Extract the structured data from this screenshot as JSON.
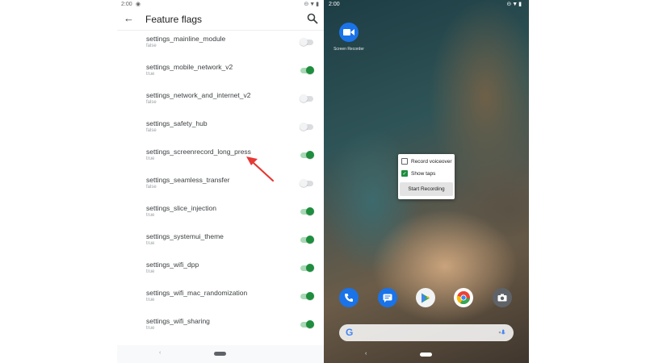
{
  "settings_screen": {
    "status_time": "2:00",
    "title": "Feature flags",
    "flags": [
      {
        "name": "settings_mainline_module",
        "value": "false",
        "enabled": false
      },
      {
        "name": "settings_mobile_network_v2",
        "value": "true",
        "enabled": true
      },
      {
        "name": "settings_network_and_internet_v2",
        "value": "false",
        "enabled": false
      },
      {
        "name": "settings_safety_hub",
        "value": "false",
        "enabled": false
      },
      {
        "name": "settings_screenrecord_long_press",
        "value": "true",
        "enabled": true
      },
      {
        "name": "settings_seamless_transfer",
        "value": "false",
        "enabled": false
      },
      {
        "name": "settings_slice_injection",
        "value": "true",
        "enabled": true
      },
      {
        "name": "settings_systemui_theme",
        "value": "true",
        "enabled": true
      },
      {
        "name": "settings_wifi_dpp",
        "value": "true",
        "enabled": true
      },
      {
        "name": "settings_wifi_mac_randomization",
        "value": "true",
        "enabled": true
      },
      {
        "name": "settings_wifi_sharing",
        "value": "true",
        "enabled": true
      }
    ]
  },
  "home_screen": {
    "status_time": "2:00",
    "shortcut_label": "Screen Recorder",
    "popup": {
      "options": [
        {
          "label": "Record voiceover",
          "checked": false
        },
        {
          "label": "Show taps",
          "checked": true
        }
      ],
      "start_label": "Start Recording"
    },
    "dock_apps": [
      "phone-icon",
      "messages-icon",
      "play-store-icon",
      "chrome-icon",
      "camera-icon"
    ]
  },
  "colors": {
    "toggle_on": "#1e8e3e",
    "arrow": "#e53935",
    "accent_blue": "#1a73e8"
  }
}
